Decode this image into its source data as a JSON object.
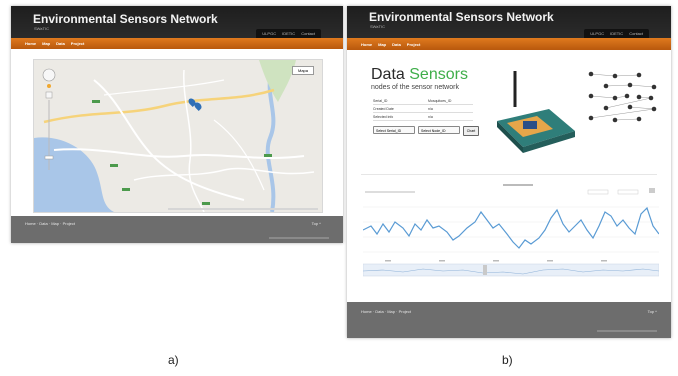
{
  "panel_a": {
    "site_title": "Environmental Sensors Network",
    "site_subtitle": "SWaTIC",
    "top_links": [
      "ULPGC",
      "IDETIC",
      "Contact"
    ],
    "nav": [
      "Home",
      "Map",
      "Data",
      "Project"
    ],
    "map_type_button": "Mapa",
    "footer_links": "Home · Data · Map · Project",
    "footer_top": "Top ^"
  },
  "panel_b": {
    "site_title": "Environmental Sensors Network",
    "site_subtitle": "SWaTIC",
    "top_links": [
      "ULPGC",
      "IDETIC",
      "Contact"
    ],
    "nav": [
      "Home",
      "Map",
      "Data",
      "Project"
    ],
    "data_heading_1": "Data",
    "data_heading_2": "Sensors",
    "data_subheading": "nodes of the sensor network",
    "info_rows": [
      {
        "label": "Serial_ID",
        "value": "Mosquitoes_ID"
      },
      {
        "label": "Created Date",
        "value": "n/a"
      },
      {
        "label": "Selected info",
        "value": "n/a"
      }
    ],
    "select_serial": "Select Serial_ID",
    "select_node": "Select Node_ID",
    "chart_button": "Chart",
    "footer_links": "Home · Data · Map · Project",
    "footer_top": "Top ^"
  },
  "captions": [
    "a)",
    "b)"
  ],
  "colors": {
    "nav": "#d06a16",
    "header": "#232323",
    "green": "#4caf50",
    "line": "#5a9bd4"
  }
}
